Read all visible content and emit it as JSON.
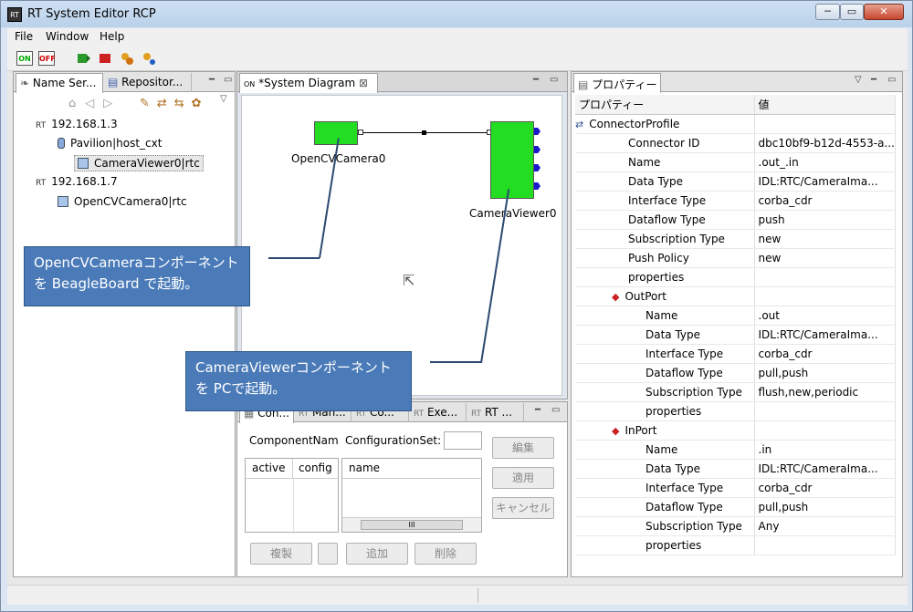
{
  "window": {
    "title": "RT System Editor RCP",
    "icon": "RT",
    "min": "─",
    "max": "▭",
    "close": "✕"
  },
  "menu": [
    "File",
    "Window",
    "Help"
  ],
  "toolbar": {
    "on": "ON",
    "off": "OFF"
  },
  "left_panel": {
    "tabs": [
      "Name Ser...",
      "Repositor..."
    ],
    "tree": [
      {
        "label": "192.168.1.3",
        "icon": "RT"
      },
      {
        "label": "Pavilion|host_cxt",
        "icon": "host-icon"
      },
      {
        "label": "CameraViewer0|rtc",
        "icon": "component-icon"
      },
      {
        "label": "192.168.1.7",
        "icon": "RT"
      },
      {
        "label": "OpenCVCamera0|rtc",
        "icon": "component-icon"
      }
    ]
  },
  "diagram": {
    "tab": "*System Diagram",
    "comp1": "OpenCVCamera0",
    "comp2": "CameraViewer0"
  },
  "callouts": {
    "a": [
      "OpenCVCameraコンポーネント",
      "を BeagleBoard で起動。"
    ],
    "b": [
      "CameraViewerコンポーネント",
      "を PCで起動。"
    ]
  },
  "bottom_panel": {
    "tabs": [
      "Con...",
      "Man...",
      "Co...",
      "Exe...",
      "RT ..."
    ],
    "component_label": "ComponentName",
    "config_label": "ConfigurationSet:",
    "col_active": "active",
    "col_config": "config",
    "col_name": "name",
    "btn_edit": "編集",
    "btn_apply": "適用",
    "btn_cancel": "キャンセル",
    "btn_copy": "複製",
    "btn_add": "追加",
    "btn_delete": "削除",
    "scroll_mark": "III"
  },
  "props": {
    "tab": "プロパティー",
    "col_prop": "プロパティー",
    "col_val": "値",
    "rows": [
      {
        "k": "ConnectorProfile",
        "v": "",
        "lvl": 1
      },
      {
        "k": "Connector ID",
        "v": "dbc10bf9-b12d-4553-a...",
        "lvl": 2
      },
      {
        "k": "Name",
        "v": ".out_.in",
        "lvl": 2
      },
      {
        "k": "Data Type",
        "v": "IDL:RTC/CameraIma...",
        "lvl": 2
      },
      {
        "k": "Interface Type",
        "v": "corba_cdr",
        "lvl": 2
      },
      {
        "k": "Dataflow Type",
        "v": "push",
        "lvl": 2
      },
      {
        "k": "Subscription Type",
        "v": "new",
        "lvl": 2
      },
      {
        "k": "Push Policy",
        "v": "new",
        "lvl": 2
      },
      {
        "k": "properties",
        "v": "",
        "lvl": 2
      },
      {
        "k": "OutPort",
        "v": "",
        "lvl": 2
      },
      {
        "k": "Name",
        "v": ".out",
        "lvl": 3
      },
      {
        "k": "Data Type",
        "v": "IDL:RTC/CameraIma...",
        "lvl": 3
      },
      {
        "k": "Interface Type",
        "v": "corba_cdr",
        "lvl": 3
      },
      {
        "k": "Dataflow Type",
        "v": "pull,push",
        "lvl": 3
      },
      {
        "k": "Subscription Type",
        "v": "flush,new,periodic",
        "lvl": 3
      },
      {
        "k": "properties",
        "v": "",
        "lvl": 3
      },
      {
        "k": "InPort",
        "v": "",
        "lvl": 2
      },
      {
        "k": "Name",
        "v": ".in",
        "lvl": 3
      },
      {
        "k": "Data Type",
        "v": "IDL:RTC/CameraIma...",
        "lvl": 3
      },
      {
        "k": "Interface Type",
        "v": "corba_cdr",
        "lvl": 3
      },
      {
        "k": "Dataflow Type",
        "v": "pull,push",
        "lvl": 3
      },
      {
        "k": "Subscription Type",
        "v": "Any",
        "lvl": 3
      },
      {
        "k": "properties",
        "v": "",
        "lvl": 3
      }
    ]
  }
}
